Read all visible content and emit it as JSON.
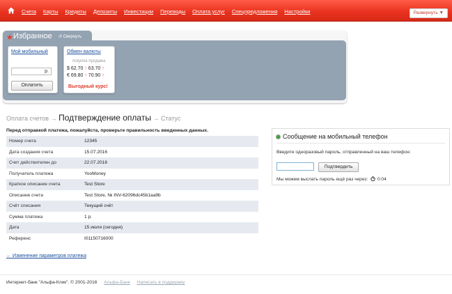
{
  "nav": {
    "items": [
      "Счета",
      "Карты",
      "Кредиты",
      "Депозиты",
      "Инвестиции",
      "Переводы",
      "Оплата услуг",
      "Спецпредложения",
      "Настройки"
    ],
    "expand_label": "Развернуть ▼"
  },
  "favorites": {
    "title": "Избранное",
    "collapse_label": "Свернуть",
    "mobile": {
      "title": "Мой мобильный",
      "currency": "р.",
      "pay_label": "Оплатить"
    },
    "rates": {
      "title": "Обмен валюты",
      "col_buy": "покупка",
      "col_sell": "продажа",
      "usd": {
        "symbol": "$",
        "buy": "62.70",
        "sell": "63.70"
      },
      "eur": {
        "symbol": "€",
        "buy": "69.80",
        "sell": "70.90"
      },
      "promo": "Выгодный курс!"
    }
  },
  "breadcrumb": {
    "step1": "Оплата счетов",
    "arrow": "→",
    "current": "Подтверждение оплаты",
    "step3": "Статус"
  },
  "details": {
    "warning": "Перед отправкой платежа, пожалуйста, проверьте правильность введенных данных.",
    "rows": [
      {
        "label": "Номер счета",
        "value": "12345"
      },
      {
        "label": "Дата создания счета",
        "value": "15.07.2016"
      },
      {
        "label": "Счет действителен до",
        "value": "22.07.2016"
      },
      {
        "label": "Получатель платежа",
        "value": "YooMoney"
      },
      {
        "label": "Краткое описание счета",
        "value": "Test Store"
      },
      {
        "label": "Описание счета",
        "value": "Test Store, № INV-62096dc45b1aa9b"
      },
      {
        "label": "Счёт списания",
        "value": "Текущий счёт"
      },
      {
        "label": "Сумма платежа",
        "value": "1 р."
      },
      {
        "label": "Дата",
        "value": "15 июля (сегодня)"
      },
      {
        "label": "Референс",
        "value": "I01150716000"
      }
    ],
    "change_link": "← Изменение параметров платежа"
  },
  "sms": {
    "title": "Сообщение на мобильный телефон",
    "hint": "Введите одноразовый пароль, отправленный на ваш телефон:",
    "otp_value": "",
    "confirm_label": "Подтвердить",
    "resend_text": "Мы можем выслать пароль ещё раз через:",
    "timer": "0:04"
  },
  "footer": {
    "copyright": "Интернет-банк \"Альфа-Клик\". © 2001-2016",
    "link1": "Альфа-Банк",
    "link2": "Написать в поддержку"
  },
  "colors": {
    "brand_red": "#e8311e",
    "panel": "#94a3b2",
    "link": "#1a4f9c"
  }
}
